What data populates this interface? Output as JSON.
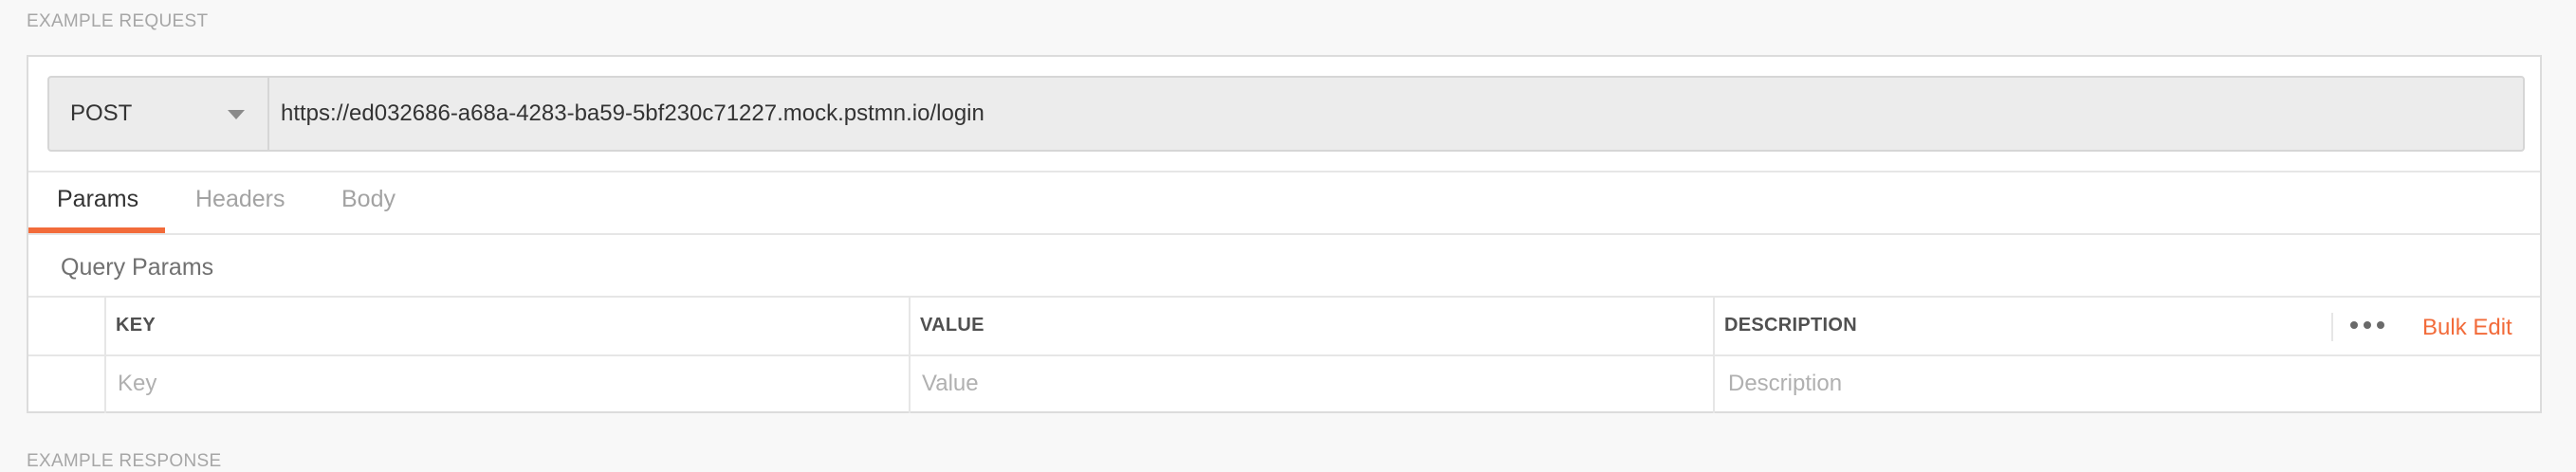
{
  "sections": {
    "request_label": "EXAMPLE REQUEST",
    "response_label": "EXAMPLE RESPONSE"
  },
  "request": {
    "method": "POST",
    "url": "https://ed032686-a68a-4283-ba59-5bf230c71227.mock.pstmn.io/login"
  },
  "tabs": [
    {
      "label": "Params",
      "active": true
    },
    {
      "label": "Headers",
      "active": false
    },
    {
      "label": "Body",
      "active": false
    }
  ],
  "query_params": {
    "title": "Query Params",
    "columns": {
      "key": "KEY",
      "value": "VALUE",
      "description": "DESCRIPTION"
    },
    "bulk_edit_label": "Bulk Edit",
    "new_row": {
      "key_placeholder": "Key",
      "value_placeholder": "Value",
      "description_placeholder": "Description"
    }
  },
  "colors": {
    "accent": "#f26b3a",
    "background": "#f8f8f8",
    "url_bar": "#ececec"
  },
  "icons": {
    "method_dropdown": "chevron-down-icon",
    "more_options": "more-horizontal-icon"
  }
}
